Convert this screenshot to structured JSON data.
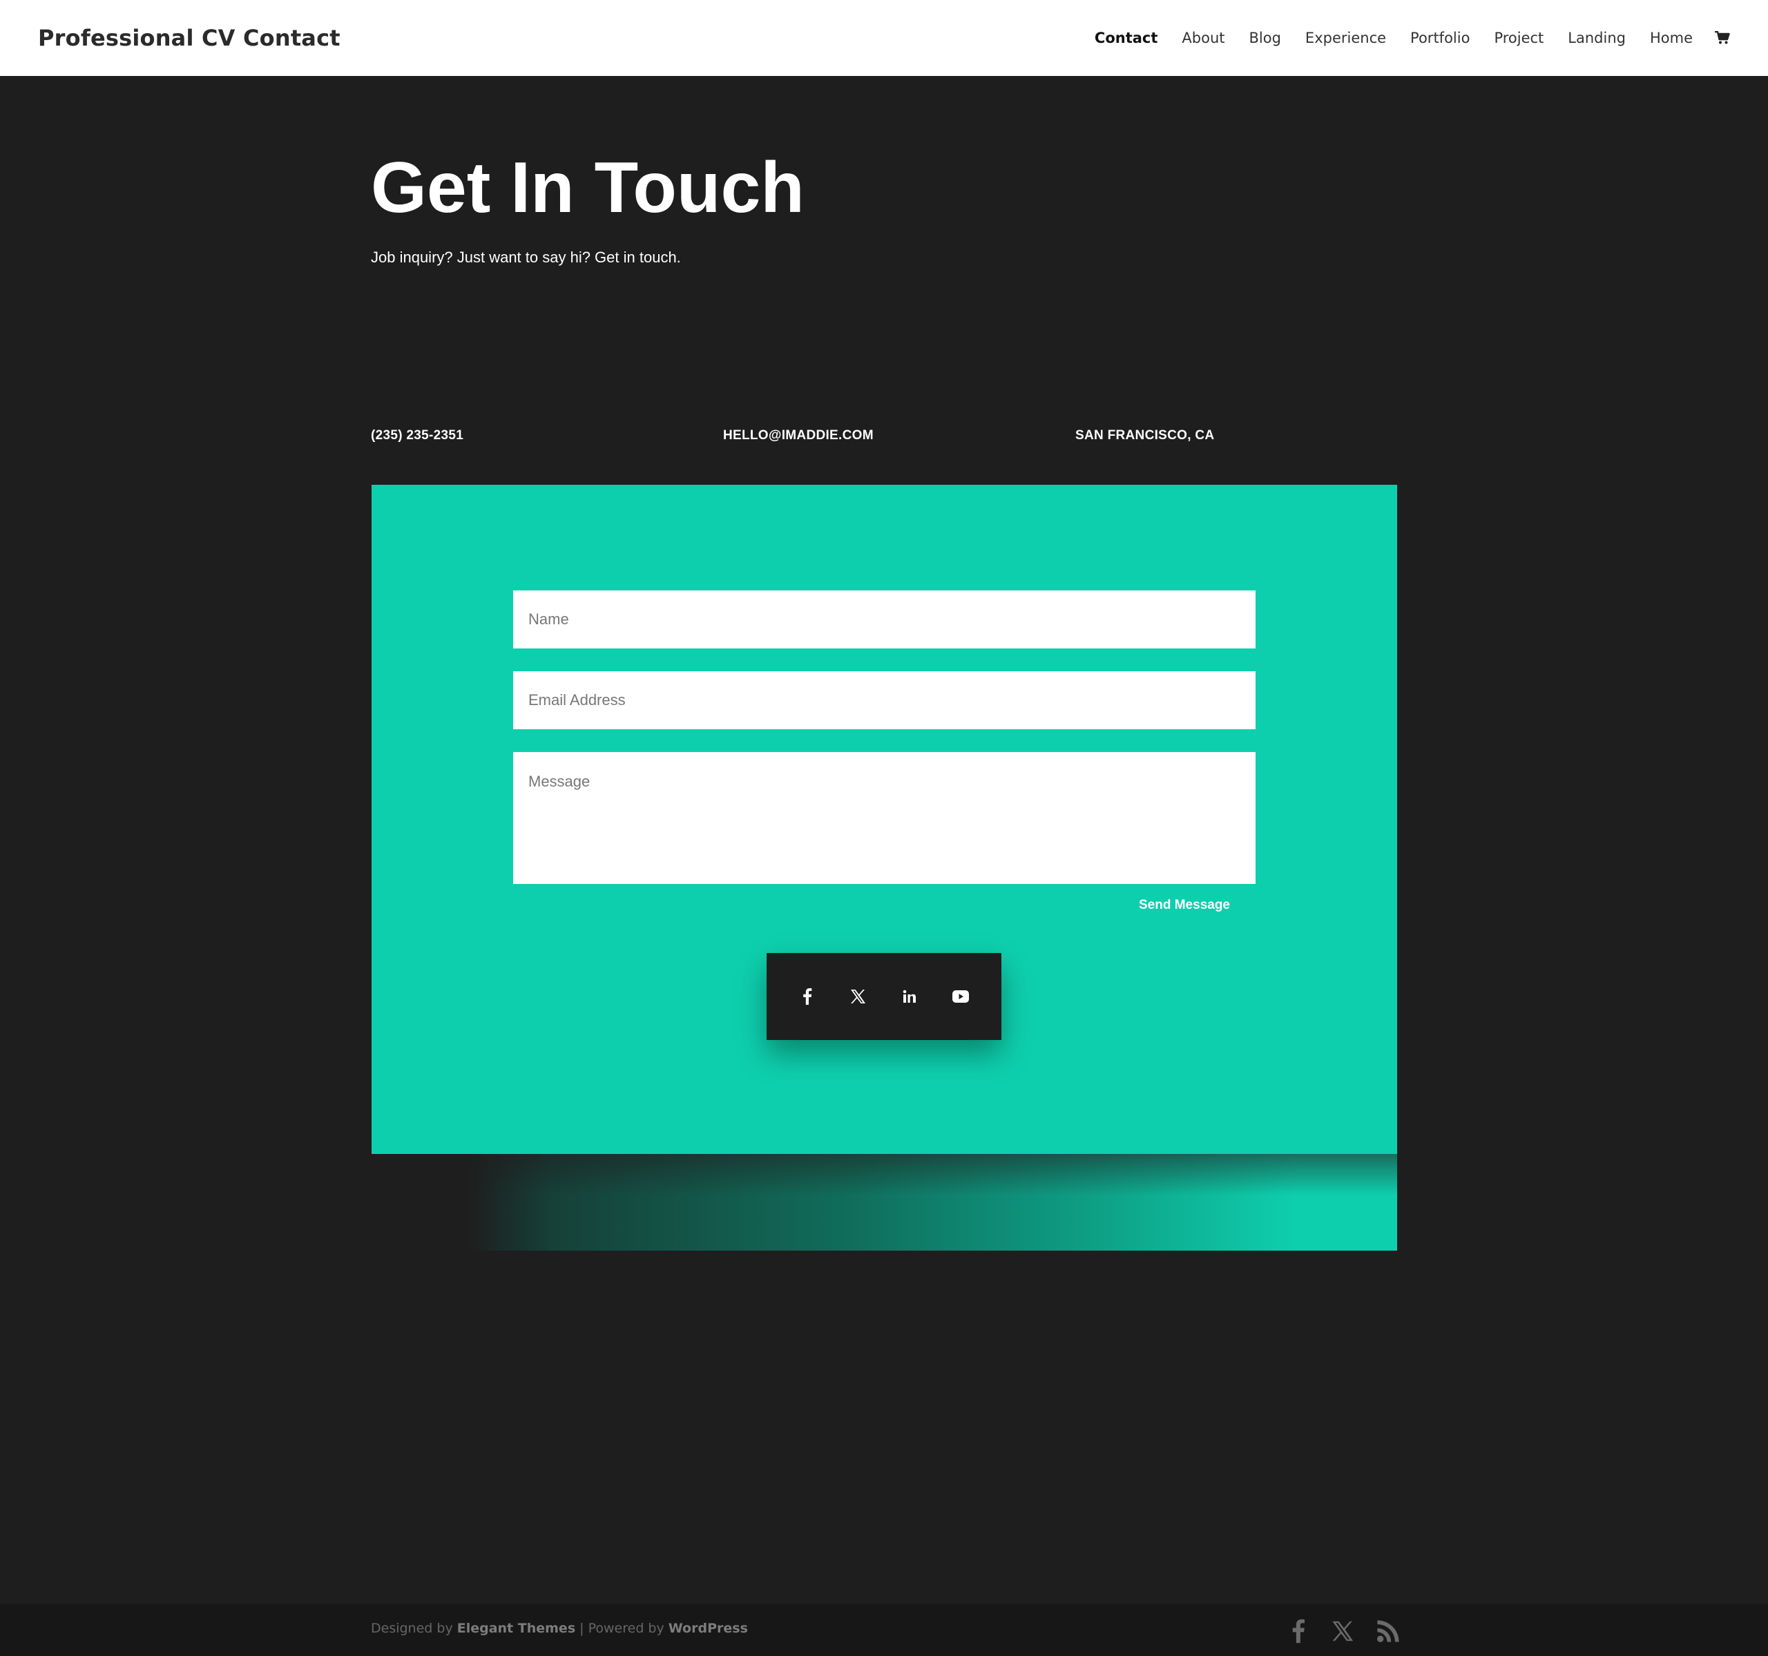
{
  "header": {
    "site_title": "Professional CV Contact",
    "nav": [
      "Contact",
      "About",
      "Blog",
      "Experience",
      "Portfolio",
      "Project",
      "Landing",
      "Home"
    ],
    "active_item": "Contact",
    "cart_icon": "cart-icon"
  },
  "hero": {
    "title": "Get In Touch",
    "subtitle": "Job inquiry? Just want to say hi? Get in touch."
  },
  "contact_info": {
    "phone": "(235) 235-2351",
    "email": "HELLO@IMADDIE.COM",
    "location": "SAN FRANCISCO, CA"
  },
  "form": {
    "name_placeholder": "Name",
    "email_placeholder": "Email Address",
    "message_placeholder": "Message",
    "submit_label": "Send Message"
  },
  "social": [
    "facebook-icon",
    "x-icon",
    "linkedin-icon",
    "youtube-icon"
  ],
  "footer": {
    "designed_by_prefix": "Designed by ",
    "designed_by_link": "Elegant Themes",
    "separator": " | Powered by ",
    "powered_by_link": "WordPress",
    "social": [
      "facebook-icon",
      "x-icon",
      "rss-icon"
    ]
  },
  "colors": {
    "background": "#1e1e1e",
    "accent": "#0ecfad",
    "header": "#ffffff",
    "footer": "#171717"
  }
}
